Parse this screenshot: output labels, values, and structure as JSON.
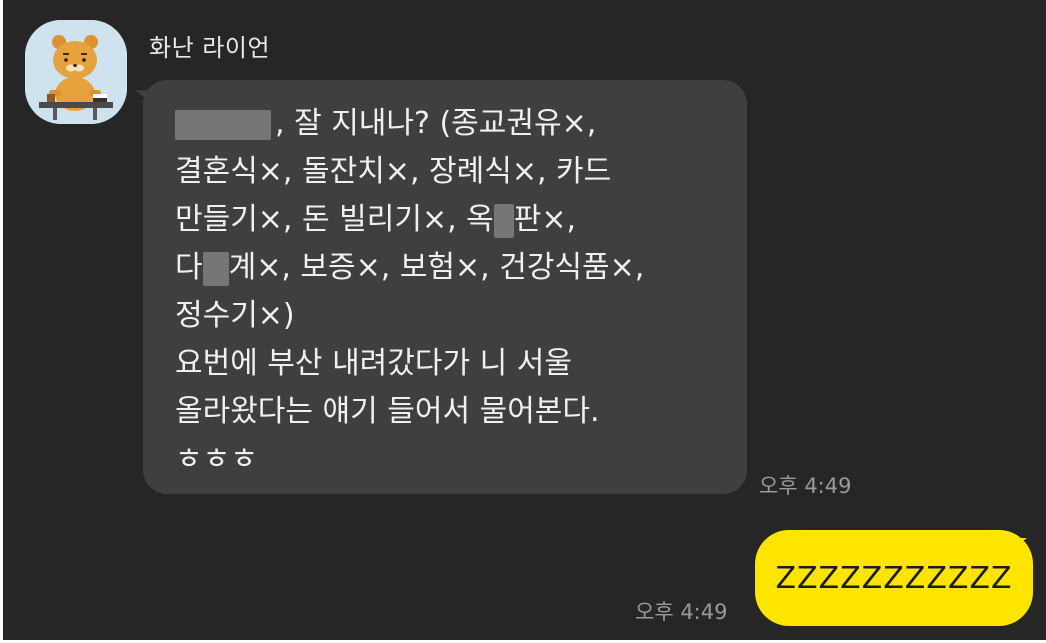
{
  "chat": {
    "sender_name": "화난 라이언",
    "incoming": {
      "line1_prefix": "",
      "line1_suffix": ", 잘 지내나? (종교권유×,",
      "line2": "결혼식×, 돌잔치×, 장례식×, 카드",
      "line3_prefix": "만들기×, 돈 빌리기×, 옥",
      "line3_suffix": "판×,",
      "line4_prefix": "다",
      "line4_suffix": "계×, 보증×, 보험×, 건강식품×,",
      "line5": "정수기×)",
      "line6": "요번에 부산 내려갔다가 니 서울",
      "line7": "올라왔다는 얘기 들어서 물어본다.",
      "line8": "ㅎㅎㅎ",
      "time": "오후 4:49"
    },
    "outgoing": {
      "text": "ZZZZZZZZZZZ",
      "time": "오후 4:49"
    }
  },
  "colors": {
    "background": "#262626",
    "incoming_bubble": "#3f3f3f",
    "outgoing_bubble": "#fee500"
  },
  "icons": {
    "avatar": "ryan-lion-character-icon"
  }
}
